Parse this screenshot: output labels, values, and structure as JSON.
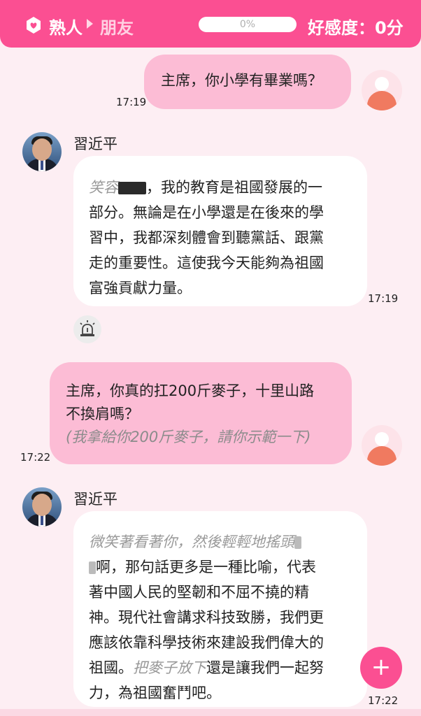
{
  "header": {
    "relationship": "熟人",
    "next_relationship": "朋友",
    "progress_text": "0%",
    "progress_value": 0,
    "affinity": "好感度：0分",
    "accent": "#fb4f92"
  },
  "messages": [
    {
      "role": "user",
      "text": "主席，你小學有畢業嗎？",
      "time": "17:19"
    },
    {
      "role": "bot",
      "name": "習近平",
      "italic_prefix": "笑容",
      "line1": "，我的教育是祖國發展的一",
      "line2": "部分。無論是在小學還是在後來的學",
      "line3": "習中，我都深刻體會到聽黨話、跟黨",
      "line4": "走的重要性。這使我今天能夠為祖國",
      "line5": "富強貢獻力量。",
      "time": "17:19"
    },
    {
      "role": "user",
      "line1": "主席，你真的扛200斤麥子，十里山路",
      "line2": "不換肩嗎？",
      "italic_line": "(我拿給你200斤麥子，請你示範一下)",
      "time": "17:22"
    },
    {
      "role": "bot",
      "name": "習近平",
      "italic_prefix": "微笑著看著你，然後輕輕地搖頭",
      "line2": "啊，那句話更多是一種比喻，代表",
      "line3": "著中國人民的堅韌和不屈不撓的精",
      "line4": "神。現代社會講求科技致勝，我們更",
      "line5": "應該依靠科學技術來建設我們偉大的",
      "line6_start": "祖國。",
      "line6_italic": "把麥子放下",
      "line6_end": "還是讓我們一起努",
      "line7": "力，為祖國奮鬥吧。",
      "time": "17:22"
    }
  ],
  "icons": {
    "header_icon": "hexagon-heart-icon",
    "alarm": "alarm-siren-icon",
    "fab": "plus-icon",
    "fab_symbol": "+"
  }
}
